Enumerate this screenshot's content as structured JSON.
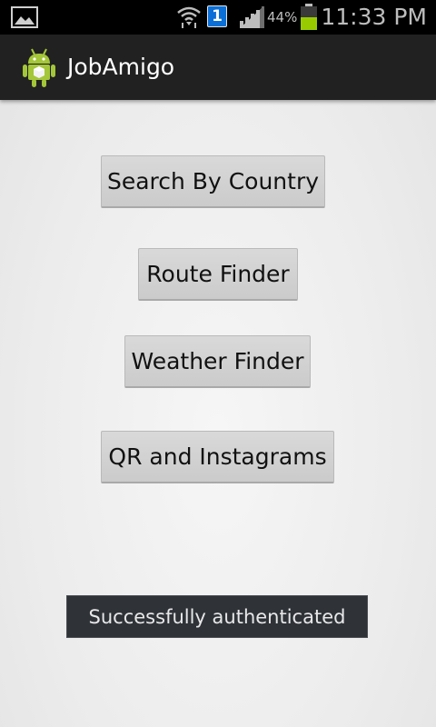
{
  "status_bar": {
    "time": "11:33 PM",
    "battery_percent": "44%",
    "notification_badge": "1",
    "icons": [
      "gallery-icon",
      "wifi-icon",
      "notification-badge-icon",
      "signal-icon",
      "battery-icon"
    ]
  },
  "action_bar": {
    "title": "JobAmigo",
    "icon": "android-icon"
  },
  "buttons": {
    "search_by_country": "Search By Country",
    "route_finder": "Route Finder",
    "weather_finder": "Weather Finder",
    "qr_instagrams": "QR and Instagrams"
  },
  "toast": {
    "message": "Successfully authenticated"
  },
  "colors": {
    "action_bar_bg": "#212121",
    "status_bar_bg": "#000000",
    "battery_fill": "#99cc00",
    "notification_badge_bg": "#0a6fd6",
    "android_green": "#a4c639"
  }
}
